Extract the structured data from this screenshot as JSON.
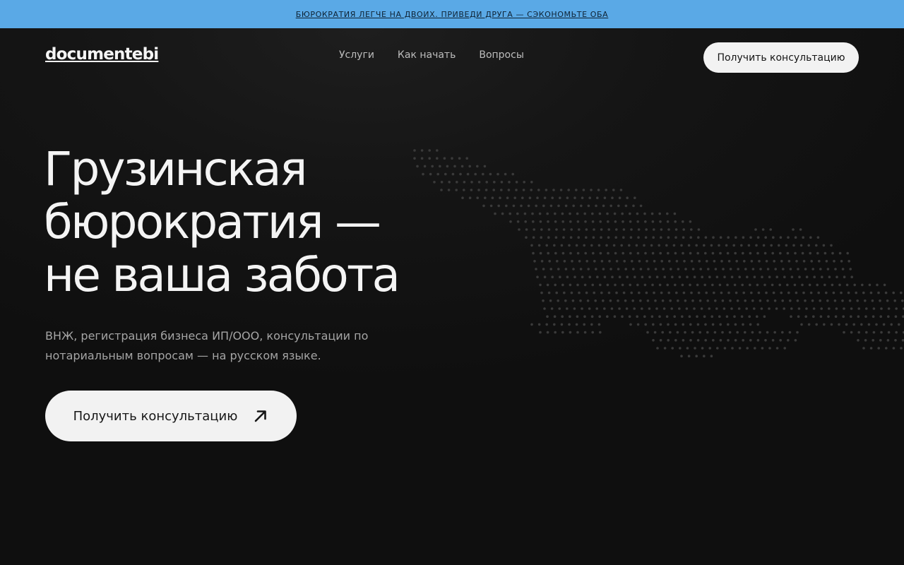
{
  "promo": {
    "text": "Бюрократия легче на двоих. Приведи друга — сэкономьте оба"
  },
  "header": {
    "logo": "documentebi",
    "nav": [
      {
        "label": "Услуги"
      },
      {
        "label": "Как начать"
      },
      {
        "label": "Вопросы"
      }
    ],
    "cta_label": "Получить консультацию"
  },
  "hero": {
    "title_lines": [
      "Грузинская",
      "бюрократия —",
      "не ваша забота"
    ],
    "subtitle": "ВНЖ, регистрация бизнеса ИП/ООО, консультации по нотариальным вопросам — на русском языке.",
    "cta_label": "Получить консультацию",
    "cta_icon": "arrow-up-right-icon"
  },
  "colors": {
    "promo_bg": "#5aa9e6",
    "page_bg": "#111111",
    "button_bg": "#f2f2f2",
    "map_dot": "#3a3a3a"
  }
}
